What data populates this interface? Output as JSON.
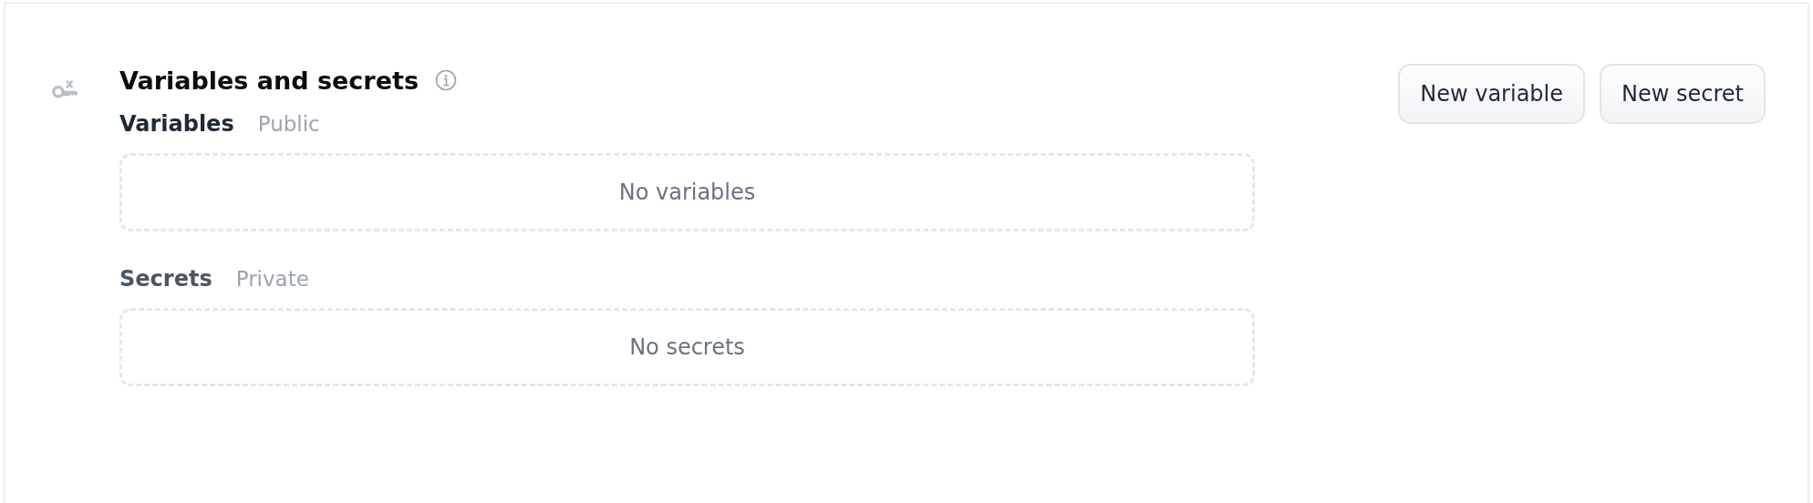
{
  "header": {
    "title": "Variables and secrets",
    "buttons": [
      "New variable",
      "New secret"
    ]
  },
  "sections": [
    {
      "title": "Variables",
      "subtitle": "Public",
      "empty_text": "No variables"
    },
    {
      "title": "Secrets",
      "subtitle": "Private",
      "empty_text": "No secrets"
    }
  ]
}
